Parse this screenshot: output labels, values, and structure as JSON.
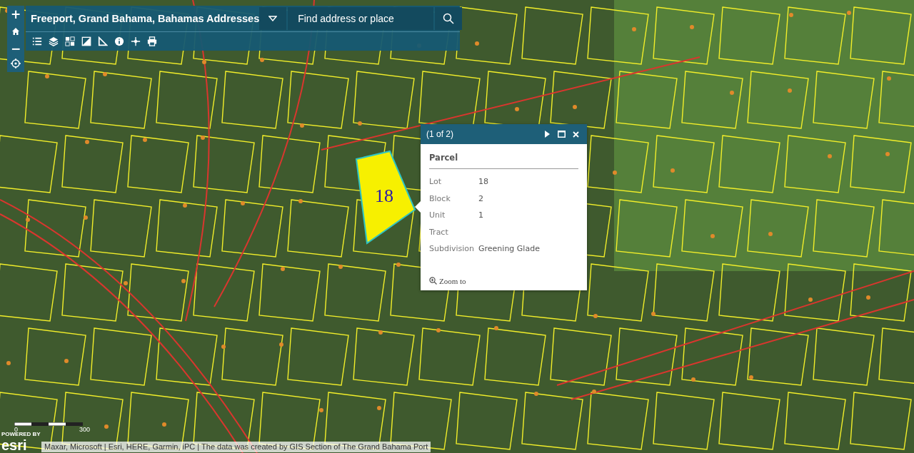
{
  "app": {
    "title": "Freeport, Grand Bahama, Bahamas Addresses",
    "search": {
      "placeholder": "Find address or place"
    }
  },
  "zoom_controls": [
    "+",
    "−"
  ],
  "toolbar": [
    {
      "kind": "legend"
    },
    {
      "kind": "layers"
    },
    {
      "kind": "basemap"
    },
    {
      "kind": "swipe"
    },
    {
      "kind": "measure"
    },
    {
      "kind": "about"
    },
    {
      "kind": "share"
    },
    {
      "kind": "print"
    }
  ],
  "map": {
    "selected_parcel_label": "18",
    "scale_labels": [
      "0",
      "300"
    ],
    "attribution": "Maxar, Microsoft | Esri, HERE, Garmin, iPC | The data was created by GIS Section of The Grand Bahama Port",
    "logo": {
      "caption": "POWERED BY",
      "wordmark": "esri"
    }
  },
  "popup": {
    "counter": "(1 of 2)",
    "title": "Parcel",
    "fields": [
      {
        "label": "Lot",
        "value": "18"
      },
      {
        "label": "Block",
        "value": "2"
      },
      {
        "label": "Unit",
        "value": "1"
      },
      {
        "label": "Tract"
      },
      {
        "label": "Subdivision",
        "value": "Greening Glade"
      }
    ],
    "action": "Zoom to"
  }
}
